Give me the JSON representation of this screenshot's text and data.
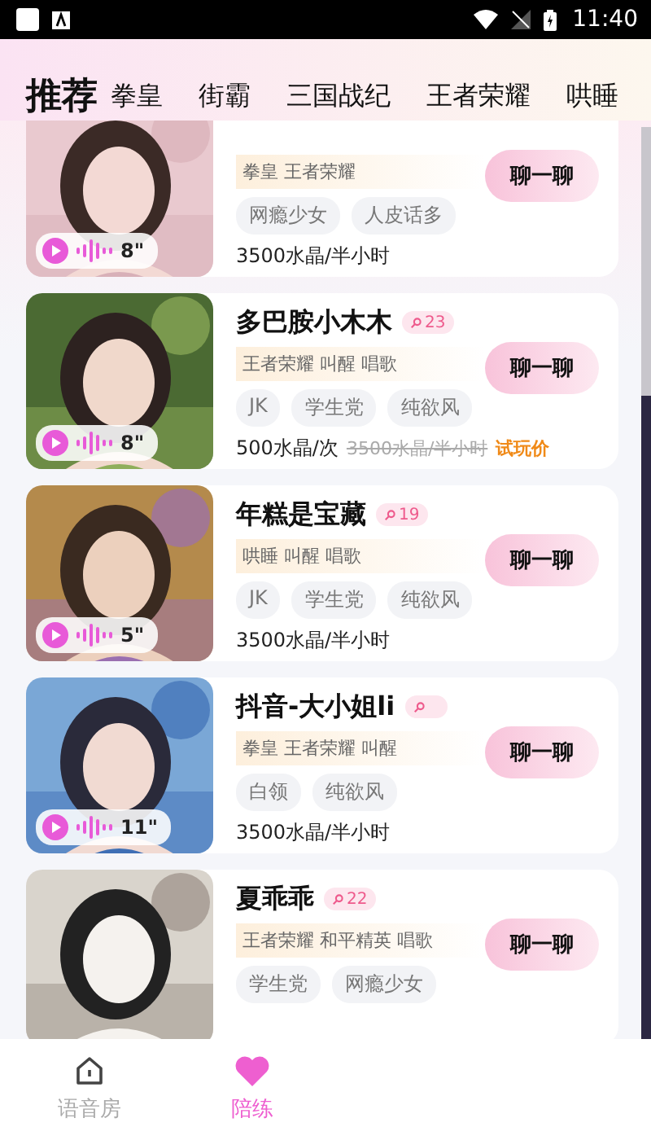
{
  "status_bar": {
    "time": "11:40"
  },
  "tabs": [
    {
      "label": "推荐",
      "selected": true
    },
    {
      "label": "拳皇",
      "selected": false
    },
    {
      "label": "街霸",
      "selected": false
    },
    {
      "label": "三国战纪",
      "selected": false
    },
    {
      "label": "王者荣耀",
      "selected": false
    },
    {
      "label": "哄睡",
      "selected": false
    }
  ],
  "cards": [
    {
      "games": "拳皇 王者荣耀",
      "tags": [
        "网瘾少女",
        "人皮话多"
      ],
      "price": "3500水晶/半小时",
      "voice": "8\"",
      "chat_button": "聊一聊"
    },
    {
      "name": "多巴胺小木木",
      "level": "23",
      "games": "王者荣耀 叫醒 唱歌",
      "tags": [
        "JK",
        "学生党",
        "纯欲风"
      ],
      "price": "500水晶/次",
      "original_price": "3500水晶/半小时",
      "promo": "试玩价",
      "voice": "8\"",
      "chat_button": "聊一聊"
    },
    {
      "name": "年糕是宝藏",
      "level": "19",
      "games": "哄睡 叫醒 唱歌",
      "tags": [
        "JK",
        "学生党",
        "纯欲风"
      ],
      "price": "3500水晶/半小时",
      "voice": "5\"",
      "chat_button": "聊一聊"
    },
    {
      "name": "抖音-大小姐li",
      "games": "拳皇 王者荣耀 叫醒",
      "tags": [
        "白领",
        "纯欲风"
      ],
      "price": "3500水晶/半小时",
      "voice": "11\"",
      "chat_button": "聊一聊"
    },
    {
      "name": "夏乖乖",
      "level": "22",
      "games": "王者荣耀 和平精英 唱歌",
      "tags": [
        "学生党",
        "网瘾少女"
      ],
      "chat_button": "聊一聊"
    }
  ],
  "bottom_nav": [
    {
      "label": "语音房",
      "selected": false
    },
    {
      "label": "陪练",
      "selected": true
    }
  ]
}
